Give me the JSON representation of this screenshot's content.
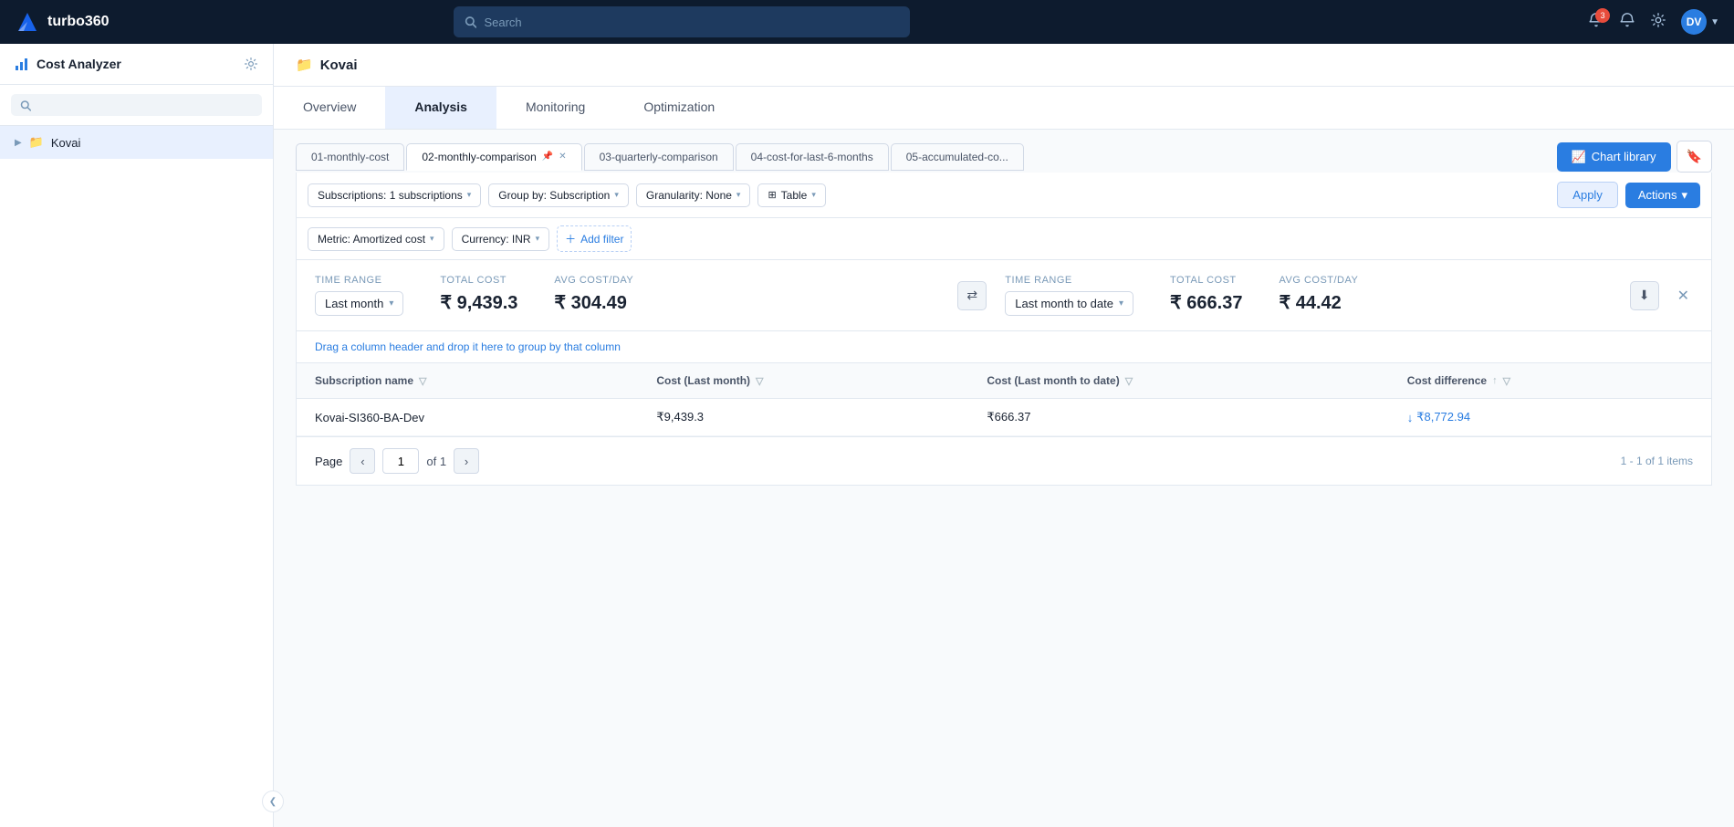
{
  "app": {
    "title": "turbo360"
  },
  "topnav": {
    "search_placeholder": "Search",
    "notification_count": "3",
    "avatar_label": "DV"
  },
  "sidebar": {
    "title": "Cost Analyzer",
    "search_placeholder": "",
    "items": [
      {
        "label": "Kovai",
        "type": "folder"
      }
    ]
  },
  "breadcrumb": {
    "icon": "📁",
    "label": "Kovai"
  },
  "main_tabs": [
    {
      "label": "Overview",
      "active": false
    },
    {
      "label": "Analysis",
      "active": true
    },
    {
      "label": "Monitoring",
      "active": false
    },
    {
      "label": "Optimization",
      "active": false
    }
  ],
  "sub_tabs": [
    {
      "label": "01-monthly-cost",
      "active": false,
      "pinned": false,
      "closable": false
    },
    {
      "label": "02-monthly-comparison",
      "active": true,
      "pinned": true,
      "closable": true
    },
    {
      "label": "03-quarterly-comparison",
      "active": false,
      "pinned": false,
      "closable": false
    },
    {
      "label": "04-cost-for-last-6-months",
      "active": false,
      "pinned": false,
      "closable": false
    },
    {
      "label": "05-accumulated-co...",
      "active": false,
      "pinned": false,
      "closable": false
    }
  ],
  "toolbar": {
    "chart_library_label": "Chart library",
    "apply_label": "Apply",
    "actions_label": "Actions"
  },
  "filters": {
    "subscriptions": "Subscriptions: 1 subscriptions",
    "group_by": "Group by: Subscription",
    "granularity": "Granularity: None",
    "view": "Table",
    "metric": "Metric: Amortized cost",
    "currency": "Currency: INR",
    "add_filter": "Add filter"
  },
  "comparison": {
    "left": {
      "time_range_label": "Time range",
      "dropdown_value": "Last month",
      "total_cost_label": "Total cost",
      "total_cost_value": "₹ 9,439.3",
      "avg_cost_label": "Avg cost/day",
      "avg_cost_value": "₹ 304.49"
    },
    "right": {
      "time_range_label": "Time range",
      "dropdown_value": "Last month to date",
      "total_cost_label": "Total cost",
      "total_cost_value": "₹ 666.37",
      "avg_cost_label": "Avg cost/day",
      "avg_cost_value": "₹ 44.42"
    }
  },
  "table": {
    "drag_hint": "Drag a column header and drop it here to group by that column",
    "columns": [
      {
        "label": "Subscription name",
        "sortable": false,
        "filterable": true
      },
      {
        "label": "Cost (Last month)",
        "sortable": false,
        "filterable": true
      },
      {
        "label": "Cost (Last month to date)",
        "sortable": false,
        "filterable": true
      },
      {
        "label": "Cost difference",
        "sortable": true,
        "filterable": true
      }
    ],
    "rows": [
      {
        "subscription_name": "Kovai-SI360-BA-Dev",
        "cost_last_month": "₹9,439.3",
        "cost_last_month_to_date": "₹666.37",
        "cost_difference": "↓₹8,772.94",
        "cost_difference_down": true
      }
    ]
  },
  "pagination": {
    "page_label": "Page",
    "page_current": "1",
    "of_label": "of 1",
    "summary": "1 - 1 of 1 items"
  }
}
